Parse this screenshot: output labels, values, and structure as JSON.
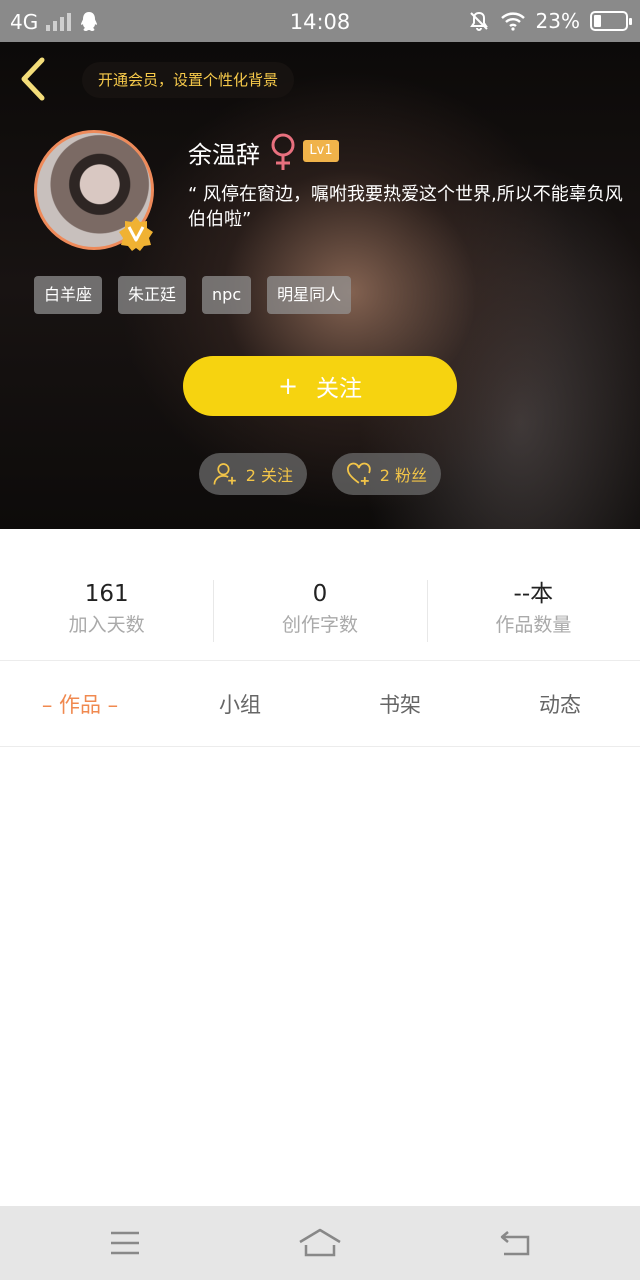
{
  "status_bar": {
    "network": "4G",
    "time": "14:08",
    "battery_percent": "23%",
    "battery_level": 0.23
  },
  "header": {
    "vip_banner": "开通会员，设置个性化背景"
  },
  "profile": {
    "username": "余温辞",
    "level": "Lv1",
    "bio": "“ 风停在窗边，嘱咐我要热爱这个世界,所以不能辜负风伯伯啦”",
    "tags": [
      "白羊座",
      "朱正廷",
      "npc",
      "明星同人"
    ],
    "follow_button": {
      "icon": "+",
      "label": "关注"
    },
    "following": "2 关注",
    "fans": "2 粉丝"
  },
  "stats": [
    {
      "value": "161",
      "label": "加入天数"
    },
    {
      "value": "0",
      "label": "创作字数"
    },
    {
      "value": "--本",
      "label": "作品数量"
    }
  ],
  "tabs": [
    {
      "label": "– 作品 –",
      "active": true
    },
    {
      "label": "小组",
      "active": false
    },
    {
      "label": "书架",
      "active": false
    },
    {
      "label": "动态",
      "active": false
    }
  ],
  "colors": {
    "accent_yellow": "#f6d310",
    "gold_text": "#f6c94a",
    "active_tab": "#f0894f",
    "avatar_ring": "#ee8a5a",
    "gender_icon": "#e8707e"
  },
  "icons": {
    "back": "chevron-left-icon",
    "gender": "female-icon",
    "verified": "vip-badge-icon",
    "following": "user-add-icon",
    "fans": "heart-add-icon",
    "nav_menu": "menu-icon",
    "nav_home": "home-icon",
    "nav_back": "back-arrow-icon"
  }
}
